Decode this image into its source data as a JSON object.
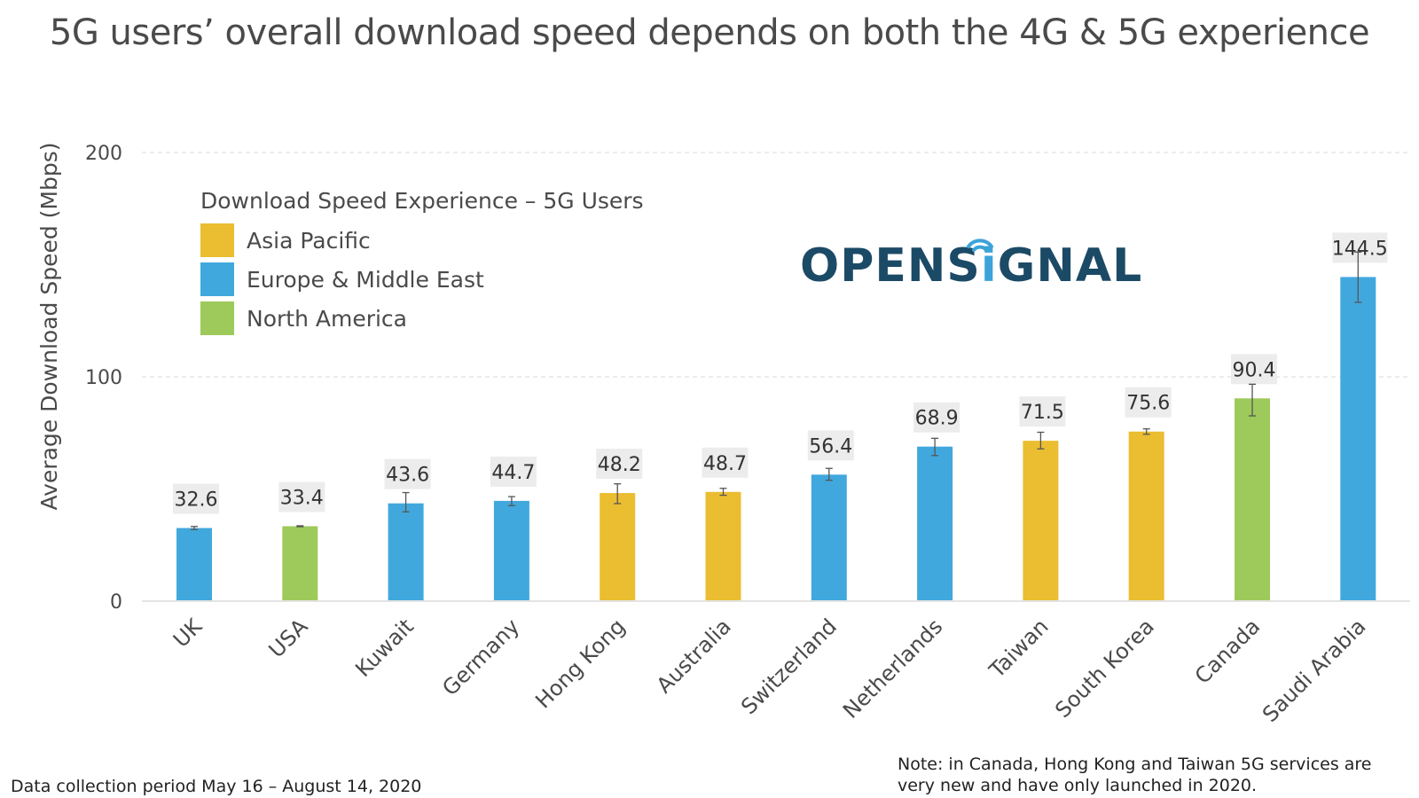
{
  "title": "5G users’ overall download speed depends on both the 4G & 5G experience",
  "logo": {
    "text_before": "OPENS",
    "text_i": "i",
    "text_after": "GNAL",
    "icon": "wifi-signal-icon"
  },
  "footer": {
    "left": "Data collection period May 16 – August 14, 2020",
    "right_line1": "Note: in Canada, Hong Kong and Taiwan 5G services are",
    "right_line2": "very new and have only launched in 2020."
  },
  "colors": {
    "Asia Pacific": "#ebbd30",
    "Europe & Middle East": "#41a8dd",
    "North America": "#9dca5b"
  },
  "chart_data": {
    "type": "bar",
    "title": "5G users’ overall download speed depends on both the 4G & 5G experience",
    "xlabel": "",
    "ylabel": "Average Download Speed (Mbps)",
    "ylim": [
      0,
      200
    ],
    "yticks": [
      0,
      100,
      200
    ],
    "grid": true,
    "legend": {
      "title": "Download Speed Experience – 5G Users",
      "placement": "top-left",
      "entries": [
        "Asia Pacific",
        "Europe & Middle East",
        "North America"
      ]
    },
    "categories": [
      "UK",
      "USA",
      "Kuwait",
      "Germany",
      "Hong Kong",
      "Australia",
      "Switzerland",
      "Netherlands",
      "Taiwan",
      "South Korea",
      "Canada",
      "Saudi Arabia"
    ],
    "values": [
      32.6,
      33.4,
      43.6,
      44.7,
      48.2,
      48.7,
      56.4,
      68.9,
      71.5,
      75.6,
      90.4,
      144.5
    ],
    "labels": [
      "32.6",
      "33.4",
      "43.6",
      "44.7",
      "48.2",
      "48.7",
      "56.4",
      "68.9",
      "71.5",
      "75.6",
      "90.4",
      "144.5"
    ],
    "regions": [
      "Europe & Middle East",
      "North America",
      "Europe & Middle East",
      "Europe & Middle East",
      "Asia Pacific",
      "Asia Pacific",
      "Europe & Middle East",
      "Europe & Middle East",
      "Asia Pacific",
      "Asia Pacific",
      "North America",
      "Europe & Middle East"
    ],
    "error_low": [
      31.9,
      33.2,
      39.8,
      42.6,
      43.5,
      47.2,
      53.9,
      64.9,
      67.9,
      74.4,
      82.6,
      133.2
    ],
    "error_high": [
      33.3,
      33.6,
      48.4,
      46.6,
      52.3,
      50.3,
      59.2,
      72.6,
      75.3,
      76.8,
      96.7,
      155.6
    ]
  }
}
